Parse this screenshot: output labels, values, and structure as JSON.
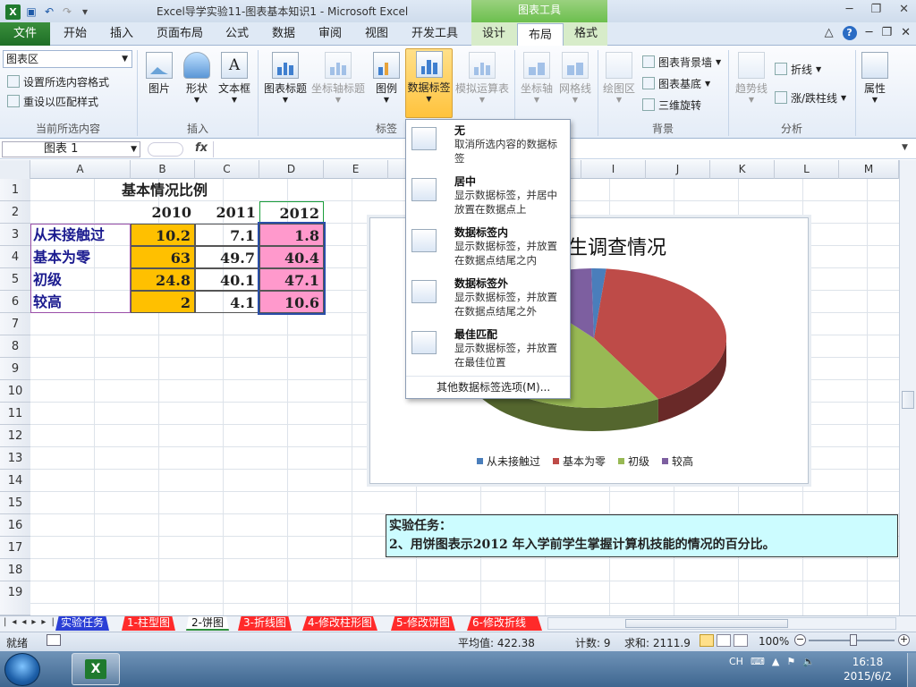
{
  "window": {
    "title": "Excel导学实验11-图表基本知识1  -  Microsoft Excel",
    "contextual_group": "图表工具",
    "controls": [
      "─",
      "❐",
      "✕"
    ]
  },
  "ribbon_tabs": [
    "文件",
    "开始",
    "插入",
    "页面布局",
    "公式",
    "数据",
    "审阅",
    "视图",
    "开发工具",
    "设计",
    "布局",
    "格式"
  ],
  "ribbon_right_icons": [
    "△",
    "?",
    "─",
    "❐",
    "✕"
  ],
  "current_selection": {
    "dropdown_value": "图表区",
    "format_selection": "设置所选内容格式",
    "reset_style": "重设以匹配样式",
    "group_label": "当前所选内容"
  },
  "insert_group": {
    "label": "插入",
    "buttons": [
      "图片",
      "形状",
      "文本框"
    ]
  },
  "labels_group": {
    "label": "标签",
    "buttons": [
      "图表标题",
      "坐标轴标题",
      "图例",
      "数据标签",
      "模拟运算表"
    ]
  },
  "axes_group": {
    "label": "坐标轴",
    "buttons": [
      "坐标轴",
      "网格线"
    ]
  },
  "background_group": {
    "label": "背景",
    "plot_area": "绘图区",
    "chart_wall": "图表背景墙",
    "chart_floor": "图表基底",
    "rotation": "三维旋转"
  },
  "analysis_group": {
    "label": "分析",
    "trendline": "趋势线",
    "lines": "折线",
    "updown_bars": "涨/跌柱线"
  },
  "properties_group": {
    "label": "属性"
  },
  "formula_bar": {
    "name_box": "图表 1",
    "fx": "fx",
    "formula": ""
  },
  "columns": [
    "A",
    "B",
    "C",
    "D",
    "E",
    "F",
    "G",
    "H",
    "I",
    "J",
    "K",
    "L",
    "M"
  ],
  "rows": [
    "1",
    "2",
    "3",
    "4",
    "5",
    "6",
    "7",
    "8",
    "9",
    "10",
    "11",
    "12",
    "13",
    "14",
    "15",
    "16",
    "17",
    "18",
    "19"
  ],
  "sheet": {
    "title": "基本情况比例",
    "headers": [
      "2010",
      "2011",
      "2012"
    ],
    "table": [
      {
        "label": "从未接触过",
        "v2010": "10.2",
        "v2011": "7.1",
        "v2012": "1.8"
      },
      {
        "label": "基本为零",
        "v2010": "63",
        "v2011": "49.7",
        "v2012": "40.4"
      },
      {
        "label": "初级",
        "v2010": "24.8",
        "v2011": "40.1",
        "v2012": "47.1"
      },
      {
        "label": "较高",
        "v2010": "2",
        "v2011": "4.1",
        "v2012": "10.6"
      }
    ],
    "task_title": "实验任务：",
    "task_text": "2、用饼图表示2012 年入学前学生掌握计算机技能的情况的百分比。"
  },
  "chart_data": {
    "type": "pie",
    "title": "生调查情况",
    "categories": [
      "从未接触过",
      "基本为零",
      "初级",
      "较高"
    ],
    "values": [
      1.8,
      40.4,
      47.1,
      10.6
    ],
    "colors": [
      "#4a7ebb",
      "#be4b48",
      "#98b954",
      "#7d5fa0"
    ],
    "legend": "bottom",
    "three_d": true
  },
  "data_labels_menu": {
    "items": [
      {
        "title": "无",
        "desc": "取消所选内容的数据标签"
      },
      {
        "title": "居中",
        "desc": "显示数据标签，并居中放置在数据点上"
      },
      {
        "title": "数据标签内",
        "desc": "显示数据标签，并放置在数据点结尾之内"
      },
      {
        "title": "数据标签外",
        "desc": "显示数据标签，并放置在数据点结尾之外"
      },
      {
        "title": "最佳匹配",
        "desc": "显示数据标签，并放置在最佳位置"
      }
    ],
    "more": "其他数据标签选项(M)..."
  },
  "sheet_tabs": [
    "实验任务",
    "1-柱型图",
    "2-饼图",
    "3-折线图",
    "4-修改柱形图",
    "5-修改饼图",
    "6-修改折线"
  ],
  "active_sheet_tab": "2-饼图",
  "status": {
    "mode": "就绪",
    "average": "平均值: 422.38",
    "count": "计数: 9",
    "sum": "求和: 2111.9",
    "zoom": "100%"
  },
  "taskbar": {
    "ime": "CH",
    "time": "16:18",
    "date": "2015/6/2"
  }
}
